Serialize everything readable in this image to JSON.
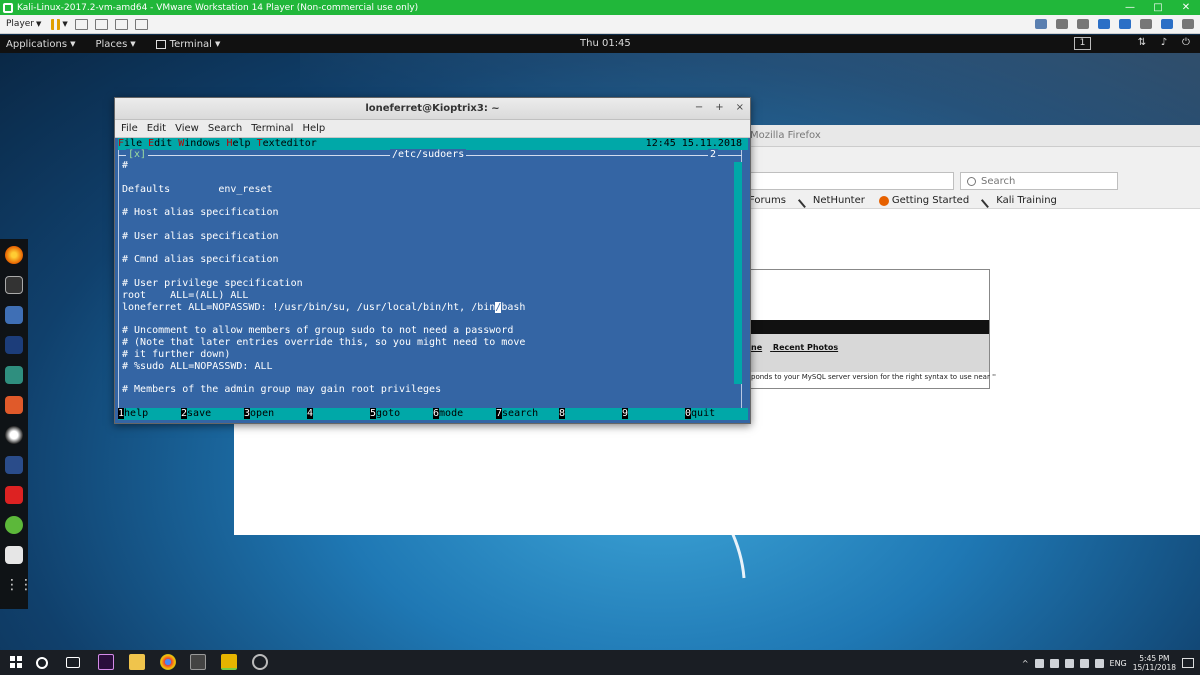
{
  "vm": {
    "title": "Kali-Linux-2017.2-vm-amd64 - VMware Workstation 14 Player (Non-commercial use only)",
    "player_label": "Player",
    "win_buttons": [
      "—",
      "□",
      "✕"
    ]
  },
  "gnome": {
    "applications": "Applications",
    "places": "Places",
    "terminal": "Terminal",
    "clock": "Thu 01:45",
    "workspace": "1"
  },
  "firefox": {
    "title": "Mozilla Firefox",
    "search_placeholder": "Search",
    "bookmarks": [
      "Forums",
      "NetHunter",
      "Getting Started",
      "Kali Training"
    ],
    "page_links": [
      "ne",
      "Recent Photos"
    ],
    "error_text": "ponds to your MySQL server version for the right syntax to use near ''"
  },
  "terminal": {
    "title": "loneferret@Kioptrix3: ~",
    "buttons": [
      "−",
      "+",
      "×"
    ],
    "menu": [
      "File",
      "Edit",
      "View",
      "Search",
      "Terminal",
      "Help"
    ],
    "mc_menu": [
      "File",
      "Edit",
      "Windows",
      "Help",
      "Texteditor"
    ],
    "mc_datetime": "12:45 15.11.2018",
    "frame_left": "[x]",
    "filename": "/etc/sudoers",
    "frame_right": "2",
    "lines": [
      "#",
      "",
      "Defaults        env_reset",
      "",
      "# Host alias specification",
      "",
      "# User alias specification",
      "",
      "# Cmnd alias specification",
      "",
      "# User privilege specification",
      "root    ALL=(ALL) ALL",
      "loneferret ALL=NOPASSWD: !/usr/bin/su, /usr/local/bin/ht, /bin/bash",
      "",
      "# Uncomment to allow members of group sudo to not need a password",
      "# (Note that later entries override this, so you might need to move",
      "# it further down)",
      "# %sudo ALL=NOPASSWD: ALL",
      "",
      "# Members of the admin group may gain root privileges"
    ],
    "fkeys": [
      {
        "num": "1",
        "label": "help"
      },
      {
        "num": "2",
        "label": "save"
      },
      {
        "num": "3",
        "label": "open"
      },
      {
        "num": "4",
        "label": ""
      },
      {
        "num": "5",
        "label": "goto"
      },
      {
        "num": "6",
        "label": "mode"
      },
      {
        "num": "7",
        "label": "search"
      },
      {
        "num": "8",
        "label": ""
      },
      {
        "num": "9",
        "label": ""
      },
      {
        "num": "0",
        "label": "quit"
      }
    ]
  },
  "taskbar": {
    "lang": "ENG",
    "time": "5:45 PM",
    "date": "15/11/2018"
  },
  "colors": {
    "vm_green": "#21b73a",
    "terminal_blue": "#3465a4",
    "mc_cyan": "#00a8a8"
  }
}
